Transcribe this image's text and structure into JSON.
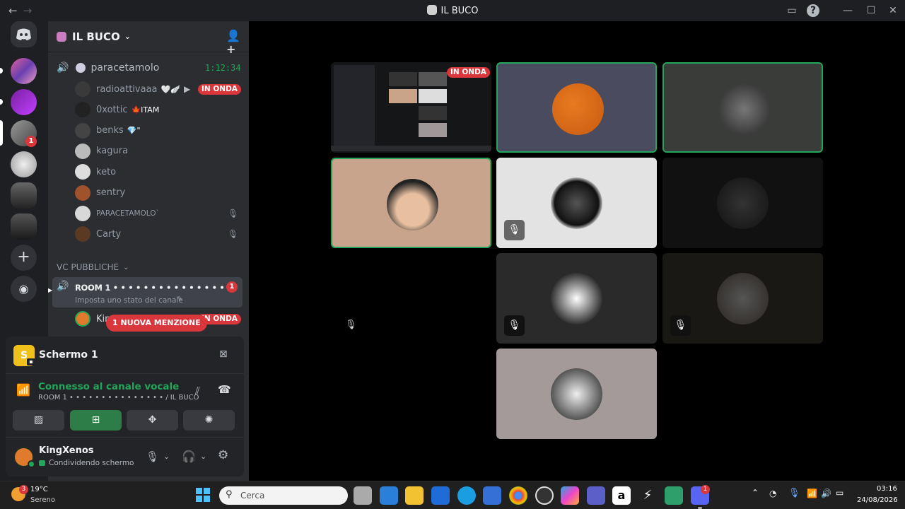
{
  "window": {
    "title": "IL BUCO"
  },
  "server": {
    "name": "IL BUCO"
  },
  "voice_channel": {
    "name": "paracetamolo",
    "timer": "1:12:34",
    "members": [
      {
        "name": "radioattivaaa",
        "suffix": "🤍🪽",
        "live": "IN ONDA",
        "color": "#3a3a3a"
      },
      {
        "name": "0xottic",
        "suffix": "🍁ITAM",
        "color": "#222"
      },
      {
        "name": "benks",
        "suffix": "💎\"",
        "color": "#444"
      },
      {
        "name": "kagura",
        "suffix": "",
        "color": "#bbb"
      },
      {
        "name": "keto",
        "suffix": "",
        "color": "#ddd"
      },
      {
        "name": "sentry",
        "suffix": "",
        "color": "#a0522d"
      },
      {
        "name": "PARACETAMOLO`",
        "suffix": "",
        "muted": true,
        "color": "#d8d8d8"
      },
      {
        "name": "Carty",
        "suffix": "",
        "muted": true,
        "color": "#5a3a22"
      }
    ]
  },
  "category": {
    "name": "VC PUBBLICHE"
  },
  "room": {
    "name": "ROOM 1 • • • • • • • • • • • • • • •",
    "status": "Imposta uno stato del canale",
    "count": "1",
    "member_partial": "Kin",
    "live": "IN ONDA"
  },
  "mention_pill": "1 NUOVA MENZIONE",
  "panel": {
    "stream_title": "Schermo 1",
    "stream_icon_letter": "S",
    "connection_status": "Connesso al canale vocale",
    "connection_channel": "ROOM 1 • • • • • • • • • • • • • • • / IL BUCO",
    "user_name": "KingXenos",
    "user_status": "Condividendo schermo"
  },
  "stage": {
    "live_badge": "IN ONDA"
  },
  "taskbar": {
    "weather_temp": "19°C",
    "weather_desc": "Sereno",
    "weather_badge": "3",
    "search_placeholder": "Cerca",
    "time": "03:16",
    "date": "24/08/2026",
    "discord_badge": "1"
  },
  "guild_badge": "1"
}
